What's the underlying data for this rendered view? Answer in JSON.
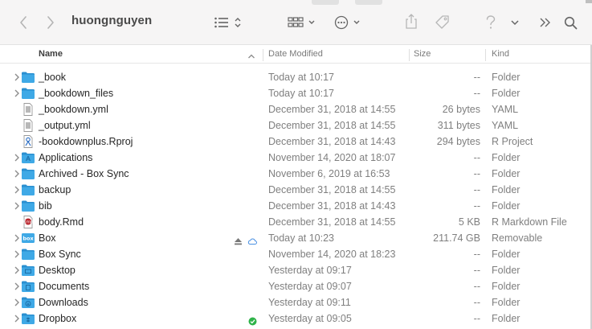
{
  "toolbar": {
    "title": "huongnguyen",
    "icons": [
      "back-chevron-icon",
      "forward-chevron-icon",
      "list-view-icon",
      "group-icon",
      "action-ellipsis-icon",
      "share-icon",
      "tag-icon",
      "help-icon",
      "chevron-down-icon",
      "more-icon",
      "search-icon"
    ]
  },
  "columns": {
    "name": "Name",
    "date": "Date Modified",
    "size": "Size",
    "kind": "Kind"
  },
  "files": [
    {
      "name": "_book",
      "date": "Today at 10:17",
      "size": "--",
      "kind": "Folder",
      "icon": "folder",
      "expandable": true
    },
    {
      "name": "_bookdown_files",
      "date": "Today at 10:17",
      "size": "--",
      "kind": "Folder",
      "icon": "folder",
      "expandable": true
    },
    {
      "name": "_bookdown.yml",
      "date": "December 31, 2018 at 14:55",
      "size": "26 bytes",
      "kind": "YAML",
      "icon": "document",
      "expandable": false
    },
    {
      "name": "_output.yml",
      "date": "December 31, 2018 at 14:55",
      "size": "311 bytes",
      "kind": "YAML",
      "icon": "document",
      "expandable": false
    },
    {
      "name": "-bookdownplus.Rproj",
      "date": "December 31, 2018 at 14:43",
      "size": "294 bytes",
      "kind": "R Project",
      "icon": "rproj",
      "expandable": false
    },
    {
      "name": "Applications",
      "date": "November 14, 2020 at 18:07",
      "size": "--",
      "kind": "Folder",
      "icon": "folder-apps",
      "expandable": true
    },
    {
      "name": "Archived - Box Sync",
      "date": "November 6, 2019 at 16:53",
      "size": "--",
      "kind": "Folder",
      "icon": "folder",
      "expandable": true
    },
    {
      "name": "backup",
      "date": "December 31, 2018 at 14:55",
      "size": "--",
      "kind": "Folder",
      "icon": "folder",
      "expandable": true
    },
    {
      "name": "bib",
      "date": "December 31, 2018 at 14:43",
      "size": "--",
      "kind": "Folder",
      "icon": "folder",
      "expandable": true
    },
    {
      "name": "body.Rmd",
      "date": "December 31, 2018 at 14:55",
      "size": "5 KB",
      "kind": "R Markdown File",
      "icon": "rmd",
      "expandable": false
    },
    {
      "name": "Box",
      "date": "Today at 10:23",
      "size": "211.74 GB",
      "kind": "Removable",
      "icon": "box",
      "expandable": true,
      "status": "eject-cloud"
    },
    {
      "name": "Box Sync",
      "date": "November 14, 2020 at 18:23",
      "size": "--",
      "kind": "Folder",
      "icon": "folder",
      "expandable": true
    },
    {
      "name": "Desktop",
      "date": "Yesterday at 09:17",
      "size": "--",
      "kind": "Folder",
      "icon": "folder-desktop",
      "expandable": true
    },
    {
      "name": "Documents",
      "date": "Yesterday at 09:07",
      "size": "--",
      "kind": "Folder",
      "icon": "folder-documents",
      "expandable": true
    },
    {
      "name": "Downloads",
      "date": "Yesterday at 09:11",
      "size": "--",
      "kind": "Folder",
      "icon": "folder-downloads",
      "expandable": true
    },
    {
      "name": "Dropbox",
      "date": "Yesterday at 09:05",
      "size": "--",
      "kind": "Folder",
      "icon": "folder-dropbox",
      "expandable": true,
      "status": "synced-check"
    }
  ],
  "colors": {
    "folder": "#3fa9e6",
    "folder_dark": "#2a8fd0",
    "check": "#2fb34a",
    "cloud": "#4a90e2",
    "rmd": "#b8242c"
  }
}
